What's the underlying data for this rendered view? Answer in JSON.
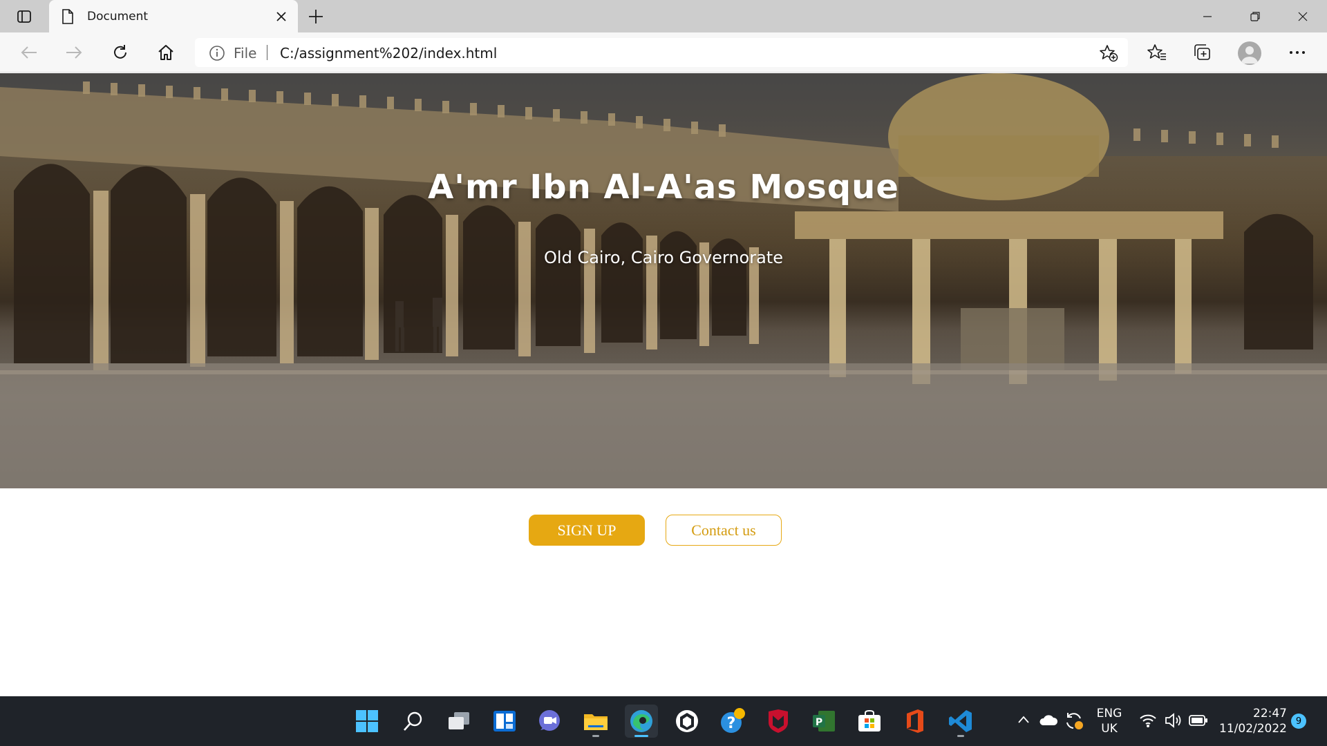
{
  "browser": {
    "tab": {
      "title": "Document"
    },
    "address": {
      "scheme_label": "File",
      "url": "C:/assignment%202/index.html"
    }
  },
  "page": {
    "hero": {
      "title": "A'mr Ibn Al-A'as Mosque",
      "subtitle": "Old Cairo, Cairo Governorate"
    },
    "buttons": {
      "signup_label": "SIGN UP",
      "contact_label": "Contact us"
    },
    "accent_color": "#e6a812"
  },
  "taskbar": {
    "apps": [
      "start",
      "search",
      "task-view",
      "widgets",
      "teams-chat",
      "file-explorer",
      "edge",
      "app-icon",
      "help",
      "mcafee",
      "project",
      "microsoft-store",
      "office",
      "vscode"
    ],
    "tray": {
      "language_top": "ENG",
      "language_bottom": "UK",
      "time": "22:47",
      "date": "11/02/2022",
      "notification_count": "9"
    }
  }
}
